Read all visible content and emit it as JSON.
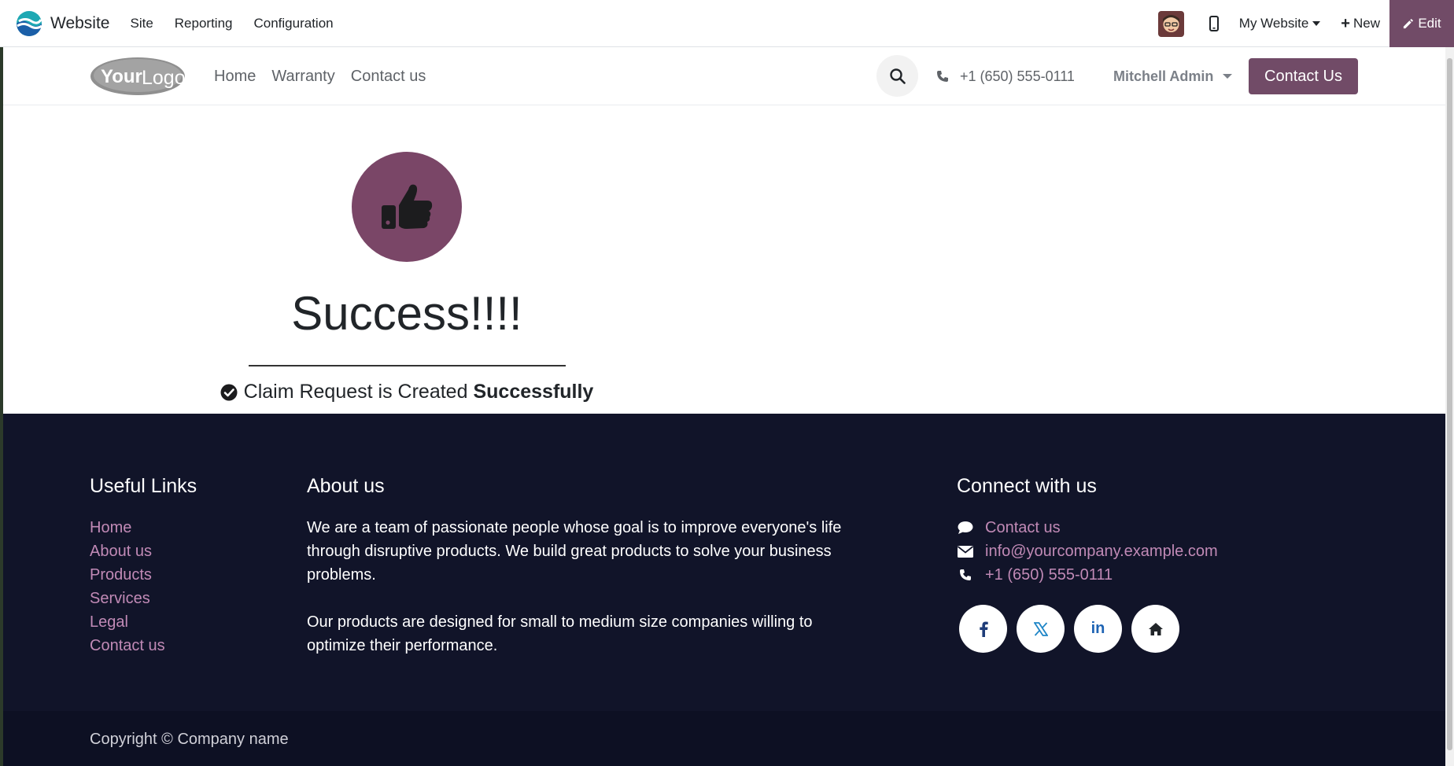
{
  "admin_bar": {
    "app_name": "Website",
    "menu": [
      "Site",
      "Reporting",
      "Configuration"
    ],
    "website_selector": "My Website",
    "new_label": "New",
    "edit_label": "Edit",
    "accent_color": "#714b67"
  },
  "site_header": {
    "logo_text": {
      "bold": "Your",
      "light": "Logo"
    },
    "nav": [
      "Home",
      "Warranty",
      "Contact us"
    ],
    "phone": "+1 (650) 555-0111",
    "user_name": "Mitchell Admin",
    "cta_label": "Contact Us"
  },
  "main": {
    "title": "Success!!!!",
    "message_prefix": "Claim Request is Created",
    "message_bold": "Successfully",
    "icon": "thumbs-up-icon"
  },
  "footer": {
    "useful_links": {
      "heading": "Useful Links",
      "items": [
        "Home",
        "About us",
        "Products",
        "Services",
        "Legal",
        "Contact us"
      ]
    },
    "about": {
      "heading": "About us",
      "paragraphs": [
        "We are a team of passionate people whose goal is to improve everyone's life through disruptive products. We build great products to solve your business problems.",
        "Our products are designed for small to medium size companies willing to optimize their performance."
      ]
    },
    "connect": {
      "heading": "Connect with us",
      "contact": "Contact us",
      "email": "info@yourcompany.example.com",
      "phone": "+1 (650) 555-0111",
      "social": [
        "facebook-icon",
        "x-icon",
        "linkedin-icon",
        "home-icon"
      ],
      "social_labels": {
        "linkedin": "in"
      }
    },
    "copyright": "Copyright © Company name"
  }
}
